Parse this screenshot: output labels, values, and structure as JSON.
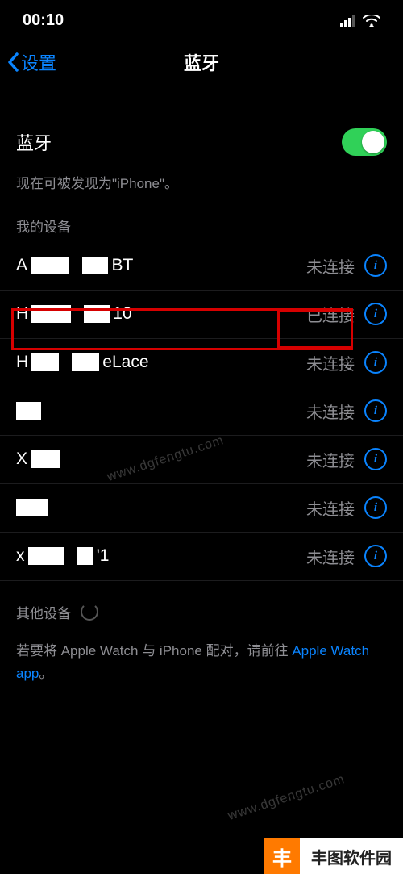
{
  "status": {
    "time": "00:10"
  },
  "nav": {
    "back": "设置",
    "title": "蓝牙"
  },
  "bluetooth": {
    "label": "蓝牙",
    "discoverable": "现在可被发现为\"iPhone\"。"
  },
  "sections": {
    "my_devices": "我的设备",
    "other_devices": "其他设备"
  },
  "status_text": {
    "not_connected": "未连接",
    "connected": "已连接"
  },
  "devices": [
    {
      "prefix": "A",
      "mid": "",
      "suffix": " BT",
      "status": "not_connected"
    },
    {
      "prefix": "H",
      "mid": "",
      "suffix": "10",
      "status": "connected",
      "highlighted": true
    },
    {
      "prefix": "H",
      "mid": "",
      "suffix": "eLace",
      "status": "not_connected"
    },
    {
      "prefix": "",
      "mid": "",
      "suffix": "",
      "status": "not_connected"
    },
    {
      "prefix": "X",
      "mid": "",
      "suffix": "",
      "status": "not_connected"
    },
    {
      "prefix": "",
      "mid": "",
      "suffix": "",
      "status": "not_connected"
    },
    {
      "prefix": "x",
      "mid": "",
      "suffix": "'1",
      "status": "not_connected"
    }
  ],
  "pairing": {
    "text_before": "若要将 Apple Watch 与 iPhone 配对，请前往 ",
    "link": "Apple Watch app",
    "text_after": "。"
  },
  "watermark": "www.dgfengtu.com",
  "source": "丰图软件园"
}
